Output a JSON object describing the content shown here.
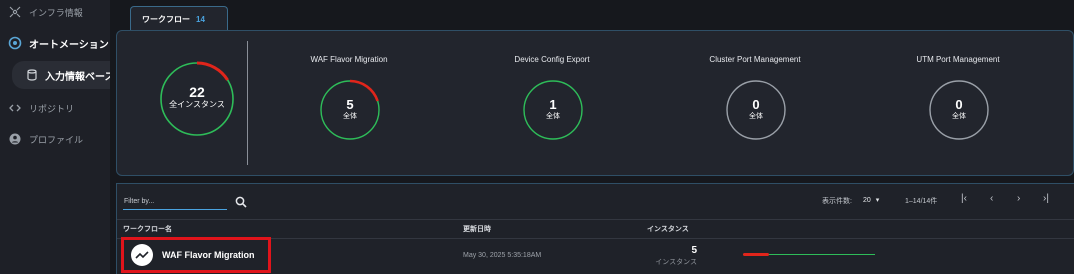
{
  "sidebar": {
    "items": [
      {
        "label": "インフラ情報",
        "icon": "network-icon"
      },
      {
        "label": "オートメーション",
        "icon": "automation-icon"
      },
      {
        "label": "入力情報ベース",
        "icon": "database-icon"
      },
      {
        "label": "リポジトリ",
        "icon": "code-icon"
      },
      {
        "label": "プロファイル",
        "icon": "user-icon"
      }
    ]
  },
  "tab": {
    "label": "ワークフロー",
    "count": "14"
  },
  "summary": {
    "total": {
      "value": "22",
      "label": "全インスタンス"
    },
    "cards": [
      {
        "title": "WAF Flavor Migration",
        "value": "5",
        "label": "全体"
      },
      {
        "title": "Device Config Export",
        "value": "1",
        "label": "全体"
      },
      {
        "title": "Cluster Port Management",
        "value": "0",
        "label": "全体"
      },
      {
        "title": "UTM Port Management",
        "value": "0",
        "label": "全体"
      }
    ]
  },
  "table": {
    "filter_placeholder": "Filter by...",
    "page_size_label": "表示件数:",
    "page_size": "20",
    "range": "1–14/14件",
    "columns": {
      "name": "ワークフロー名",
      "updated": "更新日時",
      "instances": "インスタンス"
    },
    "rows": [
      {
        "name": "WAF Flavor Migration",
        "updated": "May 30, 2025 5:35:18AM",
        "instances": "5",
        "instances_label": "インスタンス"
      }
    ]
  },
  "colors": {
    "accent": "#4aa3df",
    "success": "#2ebd59",
    "danger": "#e0251b",
    "highlight": "#e0141b"
  }
}
